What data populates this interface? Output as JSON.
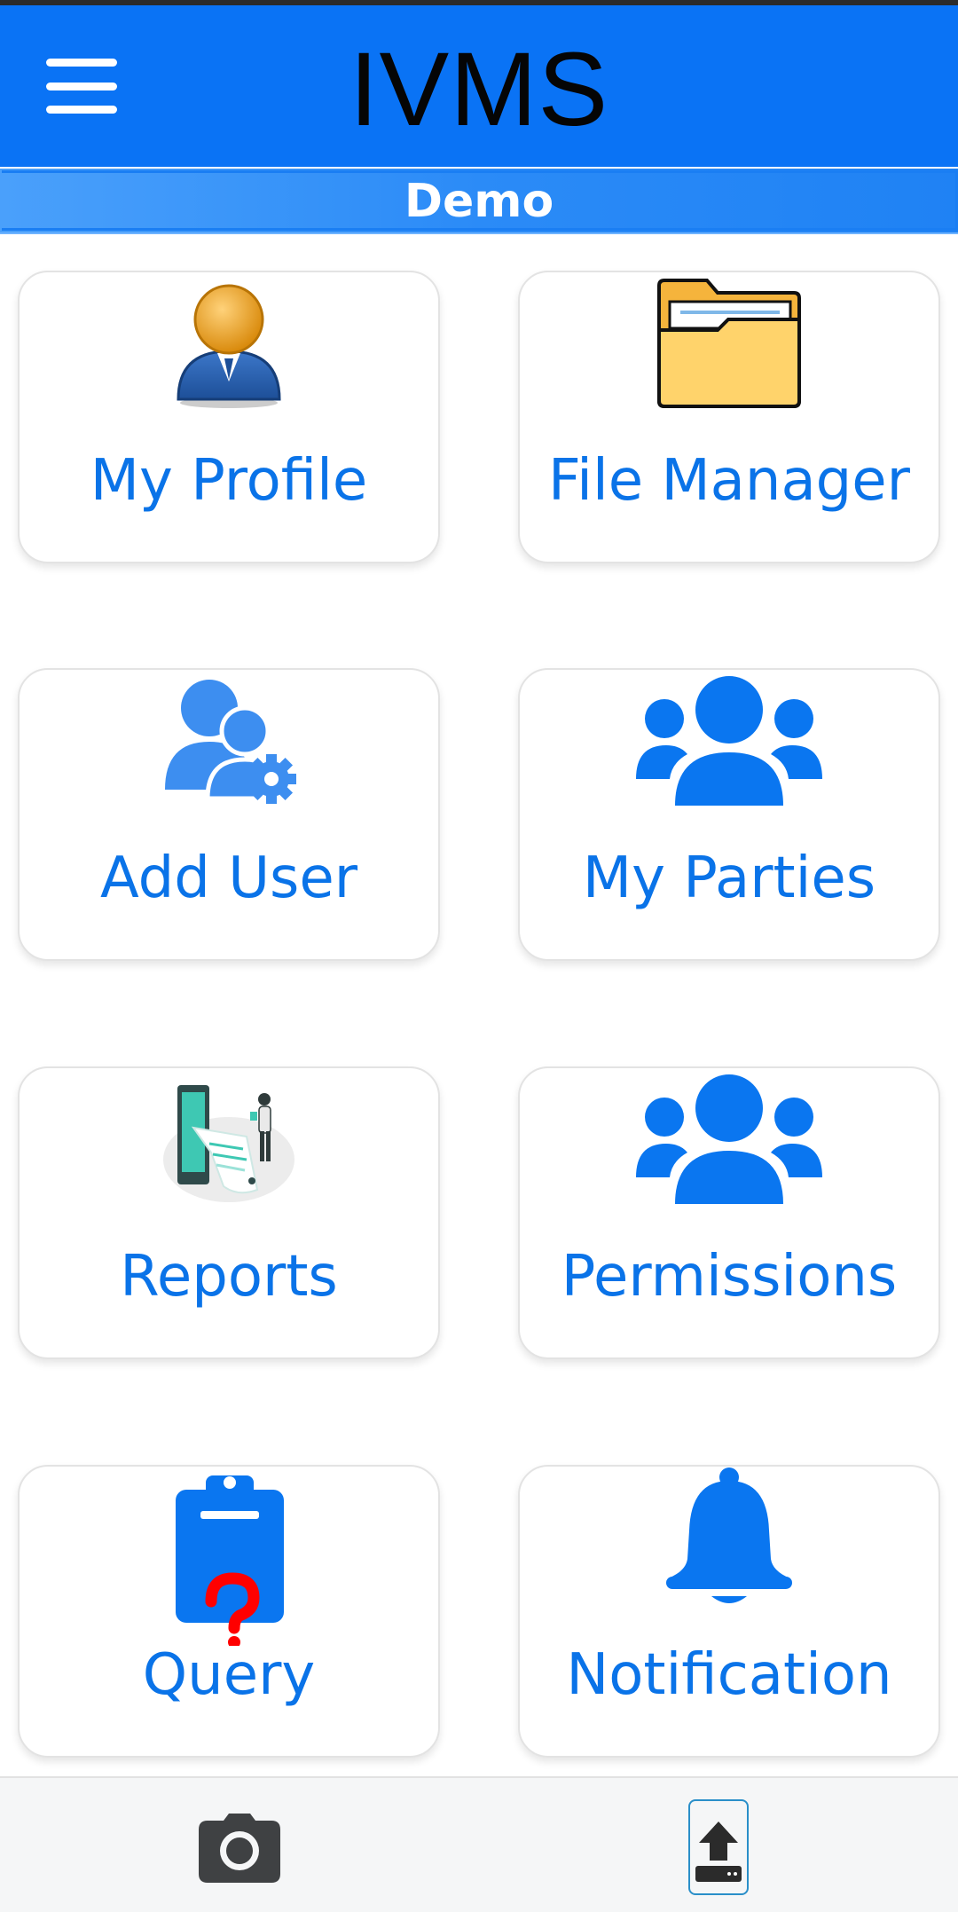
{
  "header": {
    "title": "IVMS",
    "subtitle": "Demo",
    "menu_icon": "hamburger-menu-icon"
  },
  "colors": {
    "header_bg": "#0a73f5",
    "accent": "#0a73e8",
    "card_border": "#e3e3e3"
  },
  "tiles": [
    {
      "label": "My Profile",
      "icon": "user-profile-icon"
    },
    {
      "label": "File Manager",
      "icon": "folder-icon"
    },
    {
      "label": "Add User",
      "icon": "add-user-gear-icon"
    },
    {
      "label": "My Parties",
      "icon": "users-group-icon"
    },
    {
      "label": "Reports",
      "icon": "reports-illustration-icon"
    },
    {
      "label": "Permissions",
      "icon": "users-group-icon"
    },
    {
      "label": "Query",
      "icon": "clipboard-question-icon"
    },
    {
      "label": "Notification",
      "icon": "bell-icon"
    }
  ],
  "bottom_bar": {
    "camera_icon": "camera-icon",
    "upload_icon": "upload-icon"
  }
}
